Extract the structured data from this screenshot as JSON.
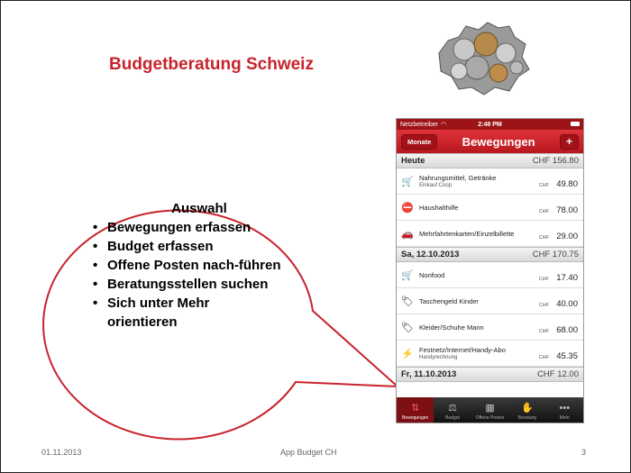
{
  "slide": {
    "title": "Budgetberatung Schweiz",
    "callout": {
      "heading": "Auswahl",
      "items": [
        "Bewegungen erfassen",
        "Budget erfassen",
        "Offene Posten nach-führen",
        "Beratungsstellen suchen",
        "Sich unter Mehr orientieren"
      ]
    },
    "footer": {
      "date": "01.11.2013",
      "center": "App Budget CH",
      "page": "3"
    }
  },
  "phone": {
    "status": {
      "carrier": "Netzbetreiber",
      "time": "2:48 PM"
    },
    "nav": {
      "left_button": "Monate",
      "title": "Bewegungen",
      "right_button": "+"
    },
    "sections": [
      {
        "date": "Heute",
        "total": "CHF 156.80",
        "rows": [
          {
            "icon": "cart-icon",
            "label": "Nahrungsmittel, Getränke",
            "sub": "Einkauf Coop",
            "currency": "CHF",
            "amount": "49.80"
          },
          {
            "icon": "no-entry-icon",
            "label": "Haushalthilfe",
            "sub": "",
            "currency": "CHF",
            "amount": "78.00"
          },
          {
            "icon": "car-icon",
            "label": "Mehrfahrtenkarten/Einzelbillette",
            "sub": "",
            "currency": "CHF",
            "amount": "29.00"
          }
        ]
      },
      {
        "date": "Sa, 12.10.2013",
        "total": "CHF 170.75",
        "rows": [
          {
            "icon": "cart-icon",
            "label": "Nonfood",
            "sub": "",
            "currency": "CHF",
            "amount": "17.40"
          },
          {
            "icon": "tag-icon",
            "label": "Taschengeld Kinder",
            "sub": "",
            "currency": "CHF",
            "amount": "40.00"
          },
          {
            "icon": "tag-icon",
            "label": "Kleider/Schuhe Mann",
            "sub": "",
            "currency": "CHF",
            "amount": "68.00"
          },
          {
            "icon": "lightning-icon",
            "label": "Festnetz/Internet/Handy-Abo",
            "sub": "Handyrechnung",
            "currency": "CHF",
            "amount": "45.35"
          }
        ]
      },
      {
        "date": "Fr, 11.10.2013",
        "total": "CHF 12.00",
        "rows": []
      }
    ],
    "tabs": [
      {
        "label": "Bewegungen",
        "icon": "transfer-icon",
        "active": true
      },
      {
        "label": "Budget",
        "icon": "scale-icon",
        "active": false
      },
      {
        "label": "Offene Posten",
        "icon": "calendar-icon",
        "active": false
      },
      {
        "label": "Beratung",
        "icon": "handshake-icon",
        "active": false
      },
      {
        "label": "Mehr",
        "icon": "more-icon",
        "active": false
      }
    ],
    "colors": {
      "accent": "#c8232c",
      "navbar": "#c41d24"
    }
  }
}
